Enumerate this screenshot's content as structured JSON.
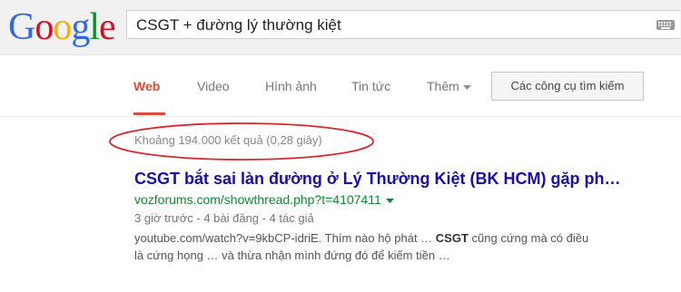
{
  "logo": {
    "letters": [
      "G",
      "o",
      "o",
      "g",
      "l",
      "e"
    ],
    "colors": [
      "#3369e8",
      "#d50f25",
      "#eeb211",
      "#3369e8",
      "#009925",
      "#d50f25"
    ]
  },
  "search": {
    "query": "CSGT + đường lý thường kiệt",
    "keyboard_icon": "keyboard-icon"
  },
  "tabs": {
    "web": "Web",
    "video": "Video",
    "images": "Hình ảnh",
    "news": "Tin tức",
    "more": "Thêm",
    "tools": "Các công cụ tìm kiếm"
  },
  "result_stats": "Khoảng 194.000 kết quả (0,28 giây)",
  "results": [
    {
      "title": "CSGT bắt sai làn đường ở Lý Thường Kiệt (BK HCM) gặp ph…",
      "url": "vozforums.com/showthread.php?t=4107411",
      "meta": "3 giờ trước - 4 bài đăng - 4 tác giả",
      "snippet_line1_pre": "youtube.com/watch?v=9kbCP-idriE. Thím nào hộ phát … ",
      "snippet_bold": "CSGT",
      "snippet_line1_post": " cũng cứng mà có điều",
      "snippet_line2": "là cứng họng … và thừa nhận mình đứng đó để kiếm tiền …"
    }
  ],
  "colors": {
    "accent_red": "#dd4b39",
    "link_blue": "#1a0dab",
    "url_green": "#0e8a2e",
    "annotation_red": "#d9272e"
  }
}
